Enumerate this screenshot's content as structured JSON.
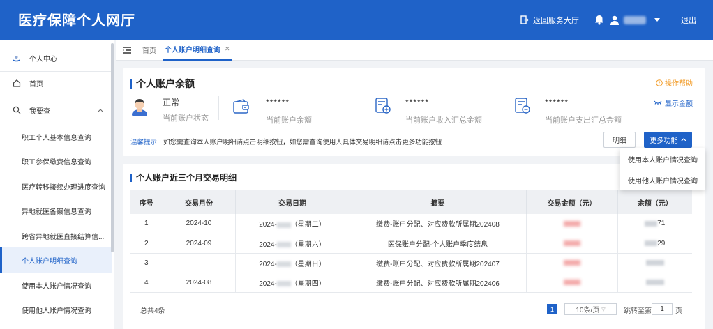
{
  "header": {
    "brand": "医疗保障个人网厅",
    "return_hall": "返回服务大厅",
    "logout": "退出"
  },
  "sidebar": {
    "items": [
      {
        "label": "个人中心",
        "icon": "user-center-icon"
      },
      {
        "label": "首页",
        "icon": "home-icon"
      },
      {
        "label": "我要查",
        "icon": "search-icon"
      },
      {
        "label": "职工个人基本信息查询"
      },
      {
        "label": "职工参保缴费信息查询"
      },
      {
        "label": "医疗转移接续办理进度查询"
      },
      {
        "label": "异地就医备案信息查询"
      },
      {
        "label": "跨省异地就医直接结算信..."
      },
      {
        "label": "个人账户明细查询"
      },
      {
        "label": "使用本人账户情况查询"
      },
      {
        "label": "使用他人账户情况查询"
      }
    ]
  },
  "tabs": {
    "home": "首页",
    "current": "个人账户明细查询"
  },
  "balance": {
    "title": "个人账户余额",
    "help": "操作帮助",
    "show_amount": "显示金额",
    "status_value": "正常",
    "status_label": "当前账户状态",
    "balance_value": "******",
    "balance_label": "当前账户余额",
    "income_value": "******",
    "income_label": "当前账户收入汇总金额",
    "expense_value": "******",
    "expense_label": "当前账户支出汇总金额",
    "tip_label": "温馨提示:",
    "tip_text": "如您需查询本人账户明细请点击明细按钮，如您需查询使用人具体交易明细请点击更多功能按钮",
    "detail_button": "明细",
    "more_button": "更多功能",
    "dropdown": [
      "使用本人账户情况查询",
      "使用他人账户情况查询"
    ]
  },
  "transactions": {
    "title": "个人账户近三个月交易明细",
    "columns": [
      "序号",
      "交易月份",
      "交易日期",
      "摘要",
      "交易金额（元）",
      "余额（元）"
    ],
    "rows": [
      {
        "no": "1",
        "month": "2024-10",
        "date_prefix": "2024-",
        "weekday": "（星期二）",
        "summary": "缴费-账户分配、对应费款所属期202408",
        "balance_tail": "71"
      },
      {
        "no": "2",
        "month": "2024-09",
        "date_prefix": "2024-",
        "weekday": "（星期六）",
        "summary": "医保账户分配-个人账户季度结息",
        "balance_tail": "29"
      },
      {
        "no": "3",
        "month": "",
        "date_prefix": "2024-",
        "weekday": "（星期日）",
        "summary": "缴费-账户分配、对应费款所属期202407",
        "balance_tail": ""
      },
      {
        "no": "4",
        "month": "2024-08",
        "date_prefix": "2024-",
        "weekday": "（星期四）",
        "summary": "缴费-账户分配、对应费款所属期202406",
        "balance_tail": ""
      }
    ],
    "total": "总共4条",
    "current_page": "1",
    "page_size": "10条/页",
    "jump_label": "跳转至第",
    "jump_value": "1",
    "page_unit": "页"
  },
  "colors": {
    "primary": "#1f62c8",
    "header": "#1f62c8",
    "help": "#f29b26",
    "amount": "#e05757"
  }
}
